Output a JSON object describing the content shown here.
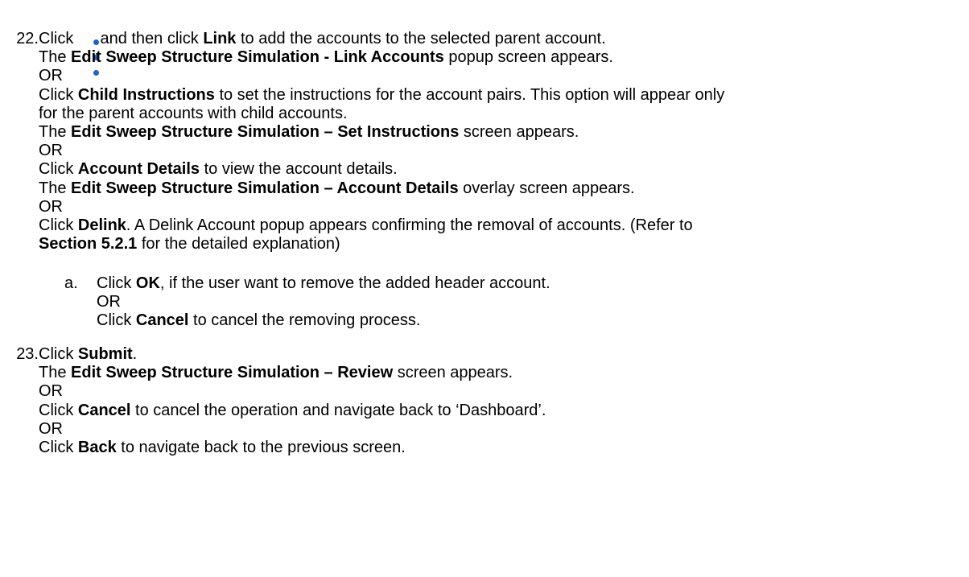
{
  "step22": {
    "number": "22.",
    "line1": {
      "a": "Click ",
      "b": " and then click ",
      "c": "Link",
      "d": " to add the accounts to the selected parent account."
    },
    "line2": {
      "a": "The ",
      "b": "Edit Sweep Structure Simulation - Link Accounts",
      "c": " popup screen appears."
    },
    "or1": "OR",
    "line4": {
      "a": "Click ",
      "b": "Child Instructions",
      "c": " to set the instructions for the account pairs. This option will appear only"
    },
    "line5": "for the parent accounts with child accounts.",
    "line6": {
      "a": "The ",
      "b": "Edit Sweep Structure Simulation – Set Instructions",
      "c": " screen appears."
    },
    "or2": "OR",
    "line8": {
      "a": "Click ",
      "b": "Account Details",
      "c": " to view the account details."
    },
    "line9": {
      "a": "The ",
      "b": "Edit Sweep Structure Simulation – Account Details",
      "c": " overlay screen appears."
    },
    "or3": "OR",
    "line11": {
      "a": "Click ",
      "b": "Delink",
      "c": ". A Delink Account popup appears confirming the removal of accounts. (Refer to"
    },
    "line12": {
      "a": "Section 5.2.1",
      "b": " for the detailed explanation)"
    },
    "sub_a": {
      "letter": "a.",
      "line1": {
        "a": "Click ",
        "b": "OK",
        "c": ", if the user want to remove the added header account."
      },
      "or": "OR",
      "line3": {
        "a": "Click ",
        "b": "Cancel",
        "c": " to cancel the removing process."
      }
    },
    "icon": "kebab-menu-icon"
  },
  "step23": {
    "number": "23.",
    "line1": {
      "a": "Click ",
      "b": "Submit",
      "c": "."
    },
    "line2": {
      "a": "The ",
      "b": "Edit Sweep Structure Simulation – Review",
      "c": " screen appears."
    },
    "or1": "OR",
    "line4": {
      "a": "Click ",
      "b": "Cancel",
      "c": " to cancel the operation and navigate back to ‘Dashboard’."
    },
    "or2": "OR",
    "line6": {
      "a": "Click ",
      "b": "Back",
      "c": " to navigate back to the previous screen."
    }
  },
  "colors": {
    "icon_blue": "#1e63c4",
    "text": "#000000"
  }
}
